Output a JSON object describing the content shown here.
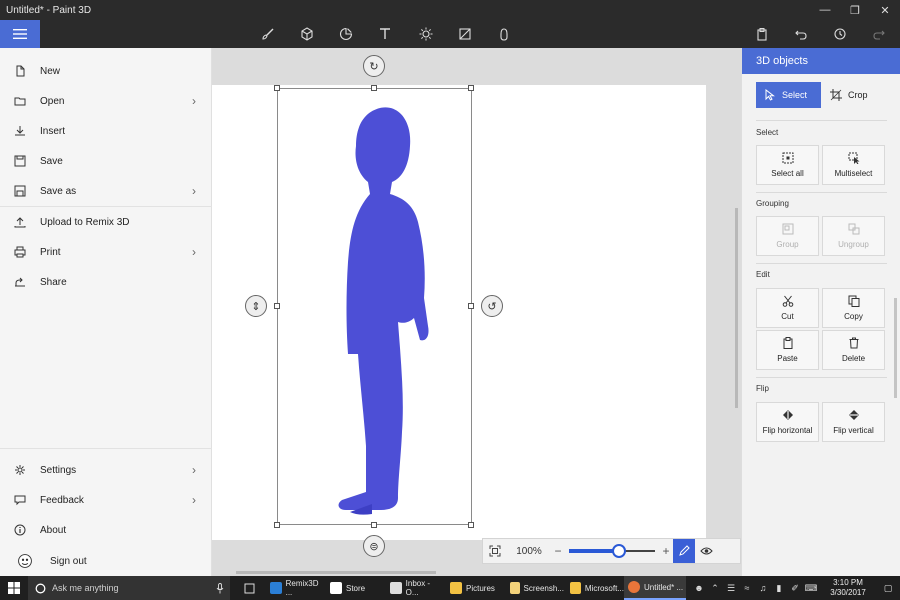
{
  "window": {
    "title": "Untitled* - Paint 3D"
  },
  "colors": {
    "accent": "#4a6cd4",
    "figure": "#4d4fd6",
    "chrome": "#2b2b2b",
    "taskbar": "#1f1f1f"
  },
  "toolbar": {
    "tools": [
      {
        "name": "brushes",
        "icon": "brush-icon"
      },
      {
        "name": "3d-objects",
        "icon": "cube-icon"
      },
      {
        "name": "stickers",
        "icon": "sticker-icon"
      },
      {
        "name": "text",
        "icon": "text-icon"
      },
      {
        "name": "effects",
        "icon": "sun-icon"
      },
      {
        "name": "canvas",
        "icon": "canvas-icon"
      },
      {
        "name": "remix-3d",
        "icon": "remix-icon"
      }
    ],
    "right": [
      "paste-icon",
      "undo-icon",
      "history-icon",
      "redo-icon"
    ]
  },
  "file_menu": {
    "items": [
      {
        "label": "New",
        "icon": "new-file-icon",
        "submenu": false
      },
      {
        "label": "Open",
        "icon": "folder-icon",
        "submenu": true
      },
      {
        "label": "Insert",
        "icon": "insert-icon",
        "submenu": false
      },
      {
        "label": "Save",
        "icon": "save-icon",
        "submenu": false
      },
      {
        "label": "Save as",
        "icon": "save-as-icon",
        "submenu": true
      },
      {
        "label": "Upload to Remix 3D",
        "icon": "upload-icon",
        "submenu": false
      },
      {
        "label": "Print",
        "icon": "print-icon",
        "submenu": true
      },
      {
        "label": "Share",
        "icon": "share-icon",
        "submenu": false
      }
    ],
    "bottom_items": [
      {
        "label": "Settings",
        "icon": "settings-icon",
        "submenu": true
      },
      {
        "label": "Feedback",
        "icon": "feedback-icon",
        "submenu": true
      },
      {
        "label": "About",
        "icon": "about-icon",
        "submenu": false
      },
      {
        "label": "Sign out",
        "icon": "avatar-icon",
        "submenu": false
      }
    ]
  },
  "zoom": {
    "label": "100%",
    "level": 0.6,
    "minus": "−",
    "plus": "+"
  },
  "panel": {
    "title": "3D objects",
    "modes": {
      "select": "Select",
      "crop": "Crop"
    },
    "sections": {
      "select": "Select",
      "grouping": "Grouping",
      "edit": "Edit",
      "flip": "Flip"
    },
    "buttons": {
      "select_all": "Select all",
      "multiselect": "Multiselect",
      "group": "Group",
      "ungroup": "Ungroup",
      "cut": "Cut",
      "copy": "Copy",
      "paste": "Paste",
      "delete": "Delete",
      "flip_horizontal": "Flip horizontal",
      "flip_vertical": "Flip vertical"
    }
  },
  "taskbar": {
    "search_placeholder": "Ask me anything",
    "apps": [
      {
        "label": "Remix3D ...",
        "color": "#2b7fd6",
        "active": false
      },
      {
        "label": "Store",
        "color": "#ffffff",
        "active": false
      },
      {
        "label": "Inbox - O...",
        "color": "#dddddd",
        "active": false
      },
      {
        "label": "Pictures",
        "color": "#f3c243",
        "active": false
      },
      {
        "label": "Screensh...",
        "color": "#f3d27a",
        "active": false
      },
      {
        "label": "Microsoft...",
        "color": "#f3c243",
        "active": false
      },
      {
        "label": "Untitled* ...",
        "color": "#e8753a",
        "active": true
      }
    ],
    "time": "3:10 PM",
    "date": "3/30/2017"
  }
}
